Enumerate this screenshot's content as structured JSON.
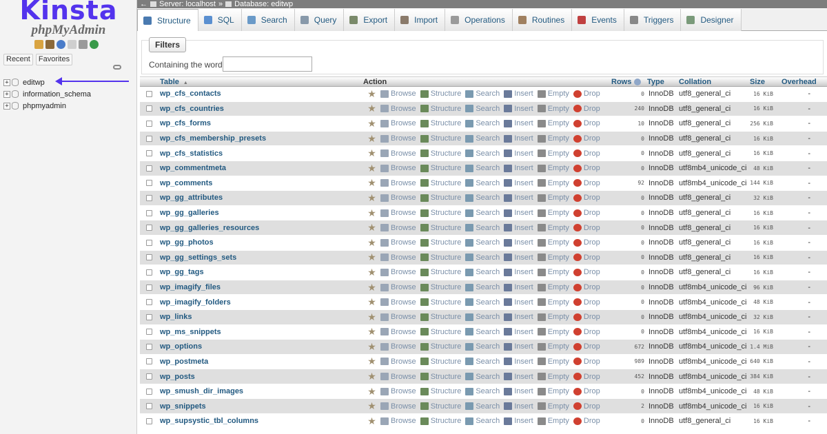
{
  "branding": {
    "logo": "Kinsta",
    "product": "phpMyAdmin"
  },
  "left": {
    "recent_label": "Recent",
    "favorites_label": "Favorites",
    "databases": [
      {
        "name": "editwp",
        "active": true
      },
      {
        "name": "information_schema"
      },
      {
        "name": "phpmyadmin"
      }
    ]
  },
  "breadcrumb": {
    "server": "Server: localhost",
    "sep": "»",
    "database": "Database: editwp"
  },
  "tabs": [
    {
      "label": "Structure",
      "active": true,
      "icon": "structure-icon",
      "color": "#4a7ab0"
    },
    {
      "label": "SQL",
      "icon": "sql-icon",
      "color": "#5a8fd0"
    },
    {
      "label": "Search",
      "icon": "search-icon",
      "color": "#6a9ac8"
    },
    {
      "label": "Query",
      "icon": "query-icon",
      "color": "#8899aa"
    },
    {
      "label": "Export",
      "icon": "export-icon",
      "color": "#7a8a6a"
    },
    {
      "label": "Import",
      "icon": "import-icon",
      "color": "#8a7a6a"
    },
    {
      "label": "Operations",
      "icon": "wrench-icon",
      "color": "#9a9a9a"
    },
    {
      "label": "Routines",
      "icon": "routines-icon",
      "color": "#a08060"
    },
    {
      "label": "Events",
      "icon": "clock-icon",
      "color": "#c04040"
    },
    {
      "label": "Triggers",
      "icon": "triggers-icon",
      "color": "#888"
    },
    {
      "label": "Designer",
      "icon": "designer-icon",
      "color": "#7a9a7a"
    }
  ],
  "filters": {
    "legend": "Filters",
    "label": "Containing the word:",
    "value": ""
  },
  "table": {
    "headers": {
      "table": "Table",
      "action": "Action",
      "rows": "Rows",
      "type": "Type",
      "collation": "Collation",
      "size": "Size",
      "overhead": "Overhead"
    },
    "actions": [
      "Browse",
      "Structure",
      "Search",
      "Insert",
      "Empty",
      "Drop"
    ],
    "rows": [
      {
        "name": "wp_cfs_contacts",
        "rows": "0",
        "type": "InnoDB",
        "collation": "utf8_general_ci",
        "size": "16 KiB",
        "overhead": "-"
      },
      {
        "name": "wp_cfs_countries",
        "rows": "240",
        "type": "InnoDB",
        "collation": "utf8_general_ci",
        "size": "16 KiB",
        "overhead": "-"
      },
      {
        "name": "wp_cfs_forms",
        "rows": "10",
        "type": "InnoDB",
        "collation": "utf8_general_ci",
        "size": "256 KiB",
        "overhead": "-"
      },
      {
        "name": "wp_cfs_membership_presets",
        "rows": "0",
        "type": "InnoDB",
        "collation": "utf8_general_ci",
        "size": "16 KiB",
        "overhead": "-"
      },
      {
        "name": "wp_cfs_statistics",
        "rows": "0",
        "type": "InnoDB",
        "collation": "utf8_general_ci",
        "size": "16 KiB",
        "overhead": "-"
      },
      {
        "name": "wp_commentmeta",
        "rows": "0",
        "type": "InnoDB",
        "collation": "utf8mb4_unicode_ci",
        "size": "48 KiB",
        "overhead": "-"
      },
      {
        "name": "wp_comments",
        "rows": "92",
        "type": "InnoDB",
        "collation": "utf8mb4_unicode_ci",
        "size": "144 KiB",
        "overhead": "-"
      },
      {
        "name": "wp_gg_attributes",
        "rows": "0",
        "type": "InnoDB",
        "collation": "utf8_general_ci",
        "size": "32 KiB",
        "overhead": "-"
      },
      {
        "name": "wp_gg_galleries",
        "rows": "0",
        "type": "InnoDB",
        "collation": "utf8_general_ci",
        "size": "16 KiB",
        "overhead": "-"
      },
      {
        "name": "wp_gg_galleries_resources",
        "rows": "0",
        "type": "InnoDB",
        "collation": "utf8_general_ci",
        "size": "16 KiB",
        "overhead": "-"
      },
      {
        "name": "wp_gg_photos",
        "rows": "0",
        "type": "InnoDB",
        "collation": "utf8_general_ci",
        "size": "16 KiB",
        "overhead": "-"
      },
      {
        "name": "wp_gg_settings_sets",
        "rows": "0",
        "type": "InnoDB",
        "collation": "utf8_general_ci",
        "size": "16 KiB",
        "overhead": "-"
      },
      {
        "name": "wp_gg_tags",
        "rows": "0",
        "type": "InnoDB",
        "collation": "utf8_general_ci",
        "size": "16 KiB",
        "overhead": "-"
      },
      {
        "name": "wp_imagify_files",
        "rows": "0",
        "type": "InnoDB",
        "collation": "utf8mb4_unicode_ci",
        "size": "96 KiB",
        "overhead": "-"
      },
      {
        "name": "wp_imagify_folders",
        "rows": "0",
        "type": "InnoDB",
        "collation": "utf8mb4_unicode_ci",
        "size": "48 KiB",
        "overhead": "-"
      },
      {
        "name": "wp_links",
        "rows": "0",
        "type": "InnoDB",
        "collation": "utf8mb4_unicode_ci",
        "size": "32 KiB",
        "overhead": "-"
      },
      {
        "name": "wp_ms_snippets",
        "rows": "0",
        "type": "InnoDB",
        "collation": "utf8mb4_unicode_ci",
        "size": "16 KiB",
        "overhead": "-"
      },
      {
        "name": "wp_options",
        "rows": "672",
        "type": "InnoDB",
        "collation": "utf8mb4_unicode_ci",
        "size": "1.4 MiB",
        "overhead": "-"
      },
      {
        "name": "wp_postmeta",
        "rows": "989",
        "type": "InnoDB",
        "collation": "utf8mb4_unicode_ci",
        "size": "640 KiB",
        "overhead": "-"
      },
      {
        "name": "wp_posts",
        "rows": "452",
        "type": "InnoDB",
        "collation": "utf8mb4_unicode_ci",
        "size": "384 KiB",
        "overhead": "-"
      },
      {
        "name": "wp_smush_dir_images",
        "rows": "0",
        "type": "InnoDB",
        "collation": "utf8mb4_unicode_ci",
        "size": "48 KiB",
        "overhead": "-"
      },
      {
        "name": "wp_snippets",
        "rows": "2",
        "type": "InnoDB",
        "collation": "utf8mb4_unicode_ci",
        "size": "16 KiB",
        "overhead": "-"
      },
      {
        "name": "wp_supsystic_tbl_columns",
        "rows": "0",
        "type": "InnoDB",
        "collation": "utf8_general_ci",
        "size": "16 KiB",
        "overhead": "-"
      }
    ]
  },
  "colors": {
    "accent": "#5333ed",
    "link": "#235a81"
  }
}
